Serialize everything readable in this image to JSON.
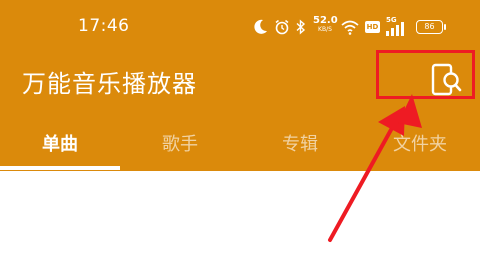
{
  "status_bar": {
    "time": "17:46",
    "net_speed_value": "52.0",
    "net_speed_unit": "KB/S",
    "hd_badge": "HD",
    "signal_label": "5G",
    "battery_level": "86"
  },
  "header": {
    "title": "万能音乐播放器",
    "background_color": "#DB8A0B"
  },
  "tabs": [
    {
      "label": "单曲",
      "active": true
    },
    {
      "label": "歌手",
      "active": false
    },
    {
      "label": "专辑",
      "active": false
    },
    {
      "label": "文件夹",
      "active": false
    }
  ],
  "annotation": {
    "color": "#EE1B23"
  },
  "icons": [
    "moon-icon",
    "alarm-icon",
    "bluetooth-icon",
    "wifi-icon",
    "hd-icon",
    "signal-icon",
    "battery-icon",
    "phone-search-icon"
  ]
}
